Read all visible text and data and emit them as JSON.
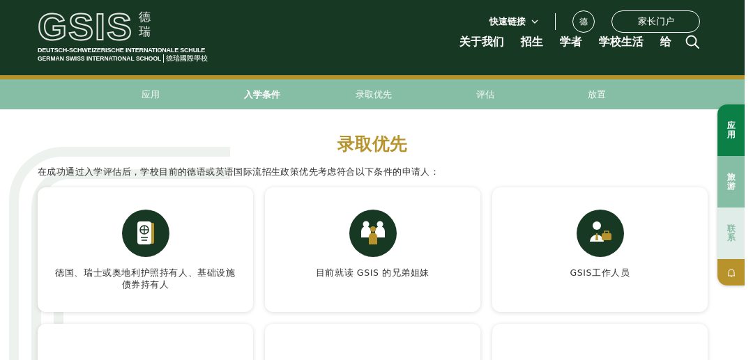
{
  "header": {
    "logo": {
      "mark": "GSIS",
      "chars": [
        "德",
        "瑞"
      ],
      "line_1": "DEUTSCH-SCHWEIZERISCHE INTERNATIONALE SCHULE",
      "line_2": "GERMAN SWISS INTERNATIONAL SCHOOL",
      "line_2_cn": "德瑞國際學校"
    },
    "quick_links": "快速链接",
    "language": "德",
    "portal": "家长门户",
    "nav": [
      "关于我们",
      "招生",
      "学者",
      "学校生活",
      "给"
    ]
  },
  "subnav": [
    {
      "label": "应用",
      "selected": false
    },
    {
      "label": "入学条件",
      "selected": true
    },
    {
      "label": "录取优先",
      "selected": false
    },
    {
      "label": "评估",
      "selected": false
    },
    {
      "label": "放置",
      "selected": false
    }
  ],
  "side_tabs": [
    {
      "kind": "text",
      "label": "应用",
      "color": "#0b7f45"
    },
    {
      "kind": "text",
      "label": "旅游",
      "color": "#86bea5"
    },
    {
      "kind": "text",
      "label": "联系",
      "color": "#e0ece7"
    },
    {
      "kind": "bell",
      "color": "#b8922a"
    }
  ],
  "section": {
    "title": "录取优先",
    "intro": "在成功通过入学评估后，学校目前的德语或英语国际流招生政策优先考虑符合以下条件的申请人：",
    "cards": [
      {
        "kind": "passport",
        "text": "德国、瑞士或奥地利护照持有人、基础设施债券持有人"
      },
      {
        "kind": "family",
        "text": "目前就读 GSIS 的兄弟姐妹"
      },
      {
        "kind": "staff",
        "text": "GSIS工作人员"
      },
      {
        "kind": "blank"
      },
      {
        "kind": "blank"
      },
      {
        "kind": "blank"
      }
    ]
  }
}
